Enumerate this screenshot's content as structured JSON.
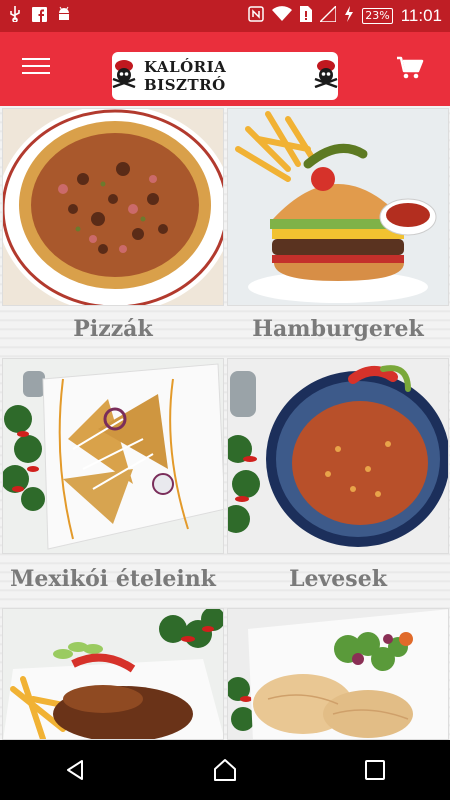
{
  "status_bar": {
    "time": "11:01",
    "battery": "23%",
    "left_icons": [
      "usb-icon",
      "facebook-icon",
      "android-icon"
    ],
    "right_icons": [
      "nfc-icon",
      "wifi-icon",
      "sim-icon",
      "signal-icon",
      "battery-charging-icon"
    ]
  },
  "app_bar": {
    "logo_text": "KALÓRIA BISZTRÓ",
    "menu_icon": "hamburger-menu-icon",
    "cart_icon": "shopping-cart-icon"
  },
  "categories": [
    {
      "label": "Pizzák",
      "image": "pizza-photo"
    },
    {
      "label": "Hamburgerek",
      "image": "hamburger-photo"
    },
    {
      "label": "Mexikói ételeink",
      "image": "quesadilla-photo"
    },
    {
      "label": "Levesek",
      "image": "soup-photo"
    },
    {
      "label": "",
      "image": "grilled-meat-photo"
    },
    {
      "label": "",
      "image": "chicken-breast-photo"
    }
  ],
  "colors": {
    "status_bar": "#bf1e25",
    "app_bar": "#ea2f3c",
    "label_text": "#7a7a7a"
  },
  "nav_bar": {
    "icons": [
      "back-icon",
      "home-icon",
      "recents-icon"
    ]
  }
}
